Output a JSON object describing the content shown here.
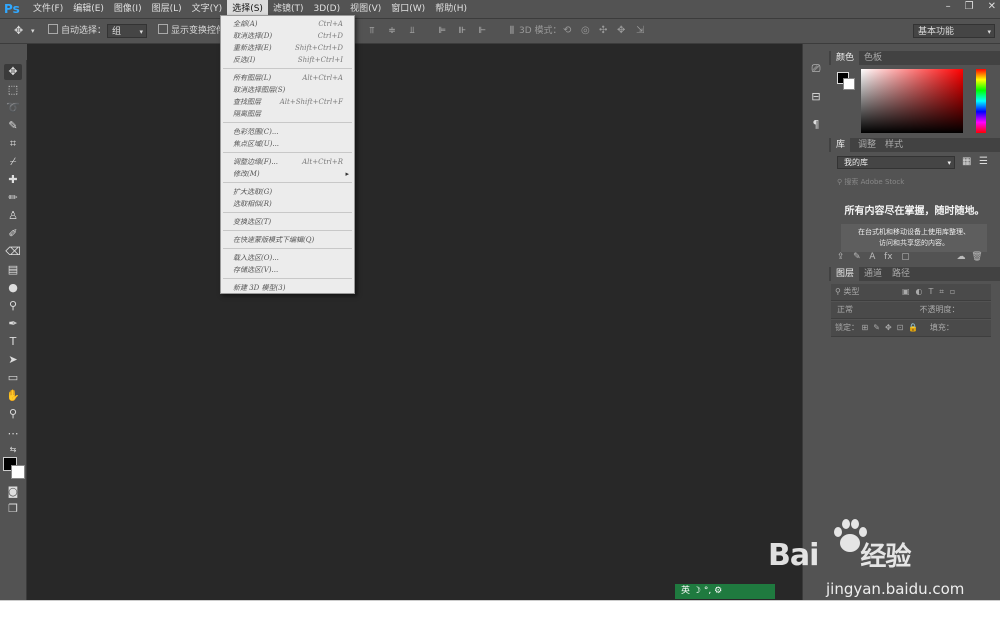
{
  "app": {
    "logo": "Ps"
  },
  "menubar": {
    "items": [
      "文件(F)",
      "编辑(E)",
      "图像(I)",
      "图层(L)",
      "文字(Y)",
      "选择(S)",
      "滤镜(T)",
      "3D(D)",
      "视图(V)",
      "窗口(W)",
      "帮助(H)"
    ],
    "active_index": 5
  },
  "window_controls": {
    "minimize": "–",
    "restore": "❐",
    "close": "✕"
  },
  "options_bar": {
    "auto_select_label": "自动选择：",
    "auto_select_value": "组",
    "show_transform_label": "显示变换控件",
    "mode_3d_label": "3D 模式：",
    "workspace": "基本功能"
  },
  "select_menu": {
    "groups": [
      [
        {
          "label": "全部(A)",
          "shortcut": "Ctrl+A"
        },
        {
          "label": "取消选择(D)",
          "shortcut": "Ctrl+D"
        },
        {
          "label": "重新选择(E)",
          "shortcut": "Shift+Ctrl+D"
        },
        {
          "label": "反选(I)",
          "shortcut": "Shift+Ctrl+I"
        }
      ],
      [
        {
          "label": "所有图层(L)",
          "shortcut": "Alt+Ctrl+A"
        },
        {
          "label": "取消选择图层(S)",
          "shortcut": ""
        },
        {
          "label": "查找图层",
          "shortcut": "Alt+Shift+Ctrl+F"
        },
        {
          "label": "隔离图层",
          "shortcut": ""
        }
      ],
      [
        {
          "label": "色彩范围(C)...",
          "shortcut": ""
        },
        {
          "label": "焦点区域(U)...",
          "shortcut": ""
        }
      ],
      [
        {
          "label": "调整边缘(F)...",
          "shortcut": "Alt+Ctrl+R"
        },
        {
          "label": "修改(M)",
          "shortcut": "",
          "submenu": "▸"
        }
      ],
      [
        {
          "label": "扩大选取(G)",
          "shortcut": ""
        },
        {
          "label": "选取相似(R)",
          "shortcut": ""
        }
      ],
      [
        {
          "label": "变换选区(T)",
          "shortcut": ""
        }
      ],
      [
        {
          "label": "在快速蒙版模式下编辑(Q)",
          "shortcut": ""
        }
      ],
      [
        {
          "label": "载入选区(O)...",
          "shortcut": ""
        },
        {
          "label": "存储选区(V)...",
          "shortcut": ""
        }
      ],
      [
        {
          "label": "新建 3D 模型(3)",
          "shortcut": ""
        }
      ]
    ]
  },
  "panels": {
    "color_tabs": [
      "颜色",
      "色板"
    ],
    "lib_tabs": [
      "库",
      "调整",
      "样式"
    ],
    "library_dropdown": "我的库",
    "library_search_placeholder": "搜索 Adobe Stock",
    "library_heading": "所有内容尽在掌握，随时随地。",
    "library_desc_line1": "在台式机和移动设备上使用库整理、",
    "library_desc_line2": "访问和共享您的内容。",
    "layer_tabs": [
      "图层",
      "通道",
      "路径"
    ],
    "layer_filter": "类型",
    "blend_mode": "正常",
    "opacity_label": "不透明度：",
    "lock_label": "锁定：",
    "fill_label": "填充："
  },
  "ime": {
    "label": "英"
  },
  "watermark": {
    "logo": "Bai",
    "logo_suffix": "经验",
    "url": "jingyan.baidu.com"
  }
}
